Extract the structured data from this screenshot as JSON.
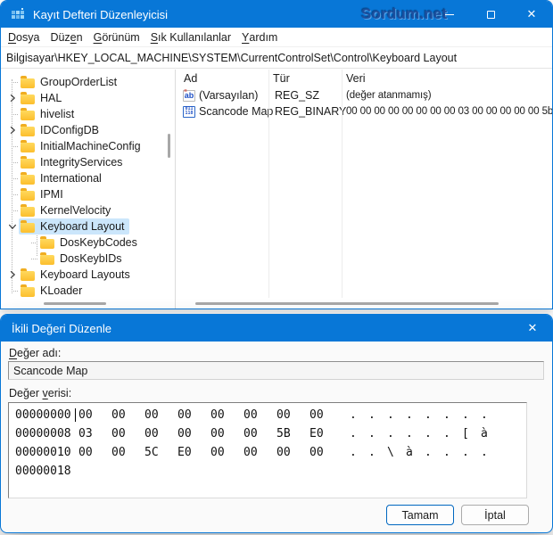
{
  "colors": {
    "accent": "#0877d7",
    "selection": "#cbe6fb",
    "folder": "#fcbe2d"
  },
  "window": {
    "title": "Kayıt Defteri Düzenleyicisi",
    "watermark": "Sordum.net",
    "close_glyph": "✕"
  },
  "menu": {
    "items": [
      {
        "pre": "",
        "accel": "D",
        "post": "osya"
      },
      {
        "pre": "Düz",
        "accel": "e",
        "post": "n"
      },
      {
        "pre": "",
        "accel": "G",
        "post": "örünüm"
      },
      {
        "pre": "",
        "accel": "S",
        "post": "ık Kullanılanlar"
      },
      {
        "pre": "",
        "accel": "Y",
        "post": "ardım"
      }
    ]
  },
  "address_bar": {
    "path": "Bilgisayar\\HKEY_LOCAL_MACHINE\\SYSTEM\\CurrentControlSet\\Control\\Keyboard Layout"
  },
  "tree": {
    "items": [
      {
        "label": "GroupOrderList",
        "level": 0,
        "chevron": "none",
        "selected": false
      },
      {
        "label": "HAL",
        "level": 0,
        "chevron": "right",
        "selected": false
      },
      {
        "label": "hivelist",
        "level": 0,
        "chevron": "none",
        "selected": false
      },
      {
        "label": "IDConfigDB",
        "level": 0,
        "chevron": "right",
        "selected": false
      },
      {
        "label": "InitialMachineConfig",
        "level": 0,
        "chevron": "none",
        "selected": false
      },
      {
        "label": "IntegrityServices",
        "level": 0,
        "chevron": "none",
        "selected": false
      },
      {
        "label": "International",
        "level": 0,
        "chevron": "none",
        "selected": false
      },
      {
        "label": "IPMI",
        "level": 0,
        "chevron": "none",
        "selected": false
      },
      {
        "label": "KernelVelocity",
        "level": 0,
        "chevron": "none",
        "selected": false
      },
      {
        "label": "Keyboard Layout",
        "level": 0,
        "chevron": "down",
        "selected": true
      },
      {
        "label": "DosKeybCodes",
        "level": 1,
        "chevron": "none",
        "selected": false
      },
      {
        "label": "DosKeybIDs",
        "level": 1,
        "chevron": "none",
        "selected": false
      },
      {
        "label": "Keyboard Layouts",
        "level": 0,
        "chevron": "right",
        "selected": false
      },
      {
        "label": "KLoader",
        "level": 0,
        "chevron": "none",
        "selected": false
      }
    ]
  },
  "values_pane": {
    "columns": [
      "Ad",
      "Tür",
      "Veri"
    ],
    "rows": [
      {
        "icon": "string-value-icon",
        "name": "(Varsayılan)",
        "type": "REG_SZ",
        "data": "(değer atanmamış)"
      },
      {
        "icon": "binary-value-icon",
        "name": "Scancode Map",
        "type": "REG_BINARY",
        "data": "00 00 00 00 00 00 00 00 03 00 00 00 00 00 5b"
      }
    ]
  },
  "dialog": {
    "title": "İkili Değeri Düzenle",
    "close_glyph": "✕",
    "value_name_label": {
      "pre": "",
      "accel": "D",
      "post": "eğer adı:"
    },
    "value_name": "Scancode Map",
    "value_data_label": {
      "pre": "Değer ",
      "accel": "v",
      "post": "erisi:"
    },
    "hex_rows": [
      {
        "offset": "00000000",
        "bytes": [
          "00",
          "00",
          "00",
          "00",
          "00",
          "00",
          "00",
          "00"
        ],
        "ascii": [
          ".",
          ".",
          ".",
          ".",
          ".",
          ".",
          ".",
          "."
        ]
      },
      {
        "offset": "00000008",
        "bytes": [
          "03",
          "00",
          "00",
          "00",
          "00",
          "00",
          "5B",
          "E0"
        ],
        "ascii": [
          ".",
          ".",
          ".",
          ".",
          ".",
          ".",
          "[",
          "à"
        ]
      },
      {
        "offset": "00000010",
        "bytes": [
          "00",
          "00",
          "5C",
          "E0",
          "00",
          "00",
          "00",
          "00"
        ],
        "ascii": [
          ".",
          ".",
          "\\",
          "à",
          ".",
          ".",
          ".",
          "."
        ]
      },
      {
        "offset": "00000018",
        "bytes": [],
        "ascii": []
      }
    ],
    "buttons": {
      "ok": "Tamam",
      "cancel": "İptal"
    }
  }
}
